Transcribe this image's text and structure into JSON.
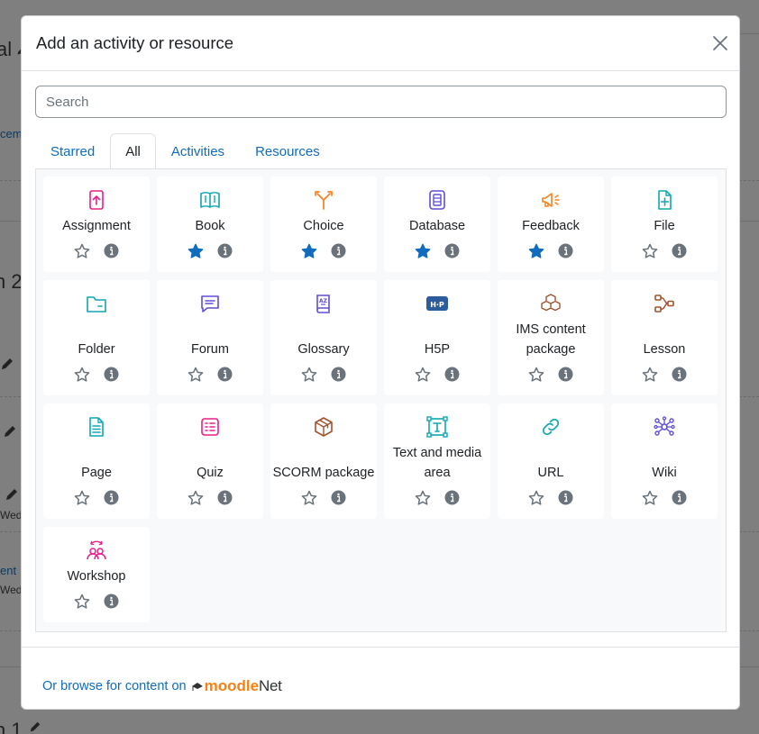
{
  "background": {
    "fragments": [
      {
        "id": "frag-al",
        "text": "al"
      },
      {
        "id": "frag-cem",
        "text": "cem"
      },
      {
        "id": "frag-n2",
        "text": "n 2"
      },
      {
        "id": "frag-ent",
        "text": "ent"
      },
      {
        "id": "frag-wed1",
        "text": "Wed"
      },
      {
        "id": "frag-wed2",
        "text": "Wed"
      },
      {
        "id": "frag-n1",
        "text": "n 1"
      }
    ]
  },
  "modal": {
    "title": "Add an activity or resource",
    "search": {
      "placeholder": "Search",
      "value": ""
    },
    "tabs": [
      {
        "label": "Starred",
        "active": false
      },
      {
        "label": "All",
        "active": true
      },
      {
        "label": "Activities",
        "active": false
      },
      {
        "label": "Resources",
        "active": false
      }
    ],
    "items": [
      {
        "name": "Assignment",
        "icon": "assignment-icon",
        "color": "#e91e8c",
        "starred": false
      },
      {
        "name": "Book",
        "icon": "book-icon",
        "color": "#11a7b3",
        "starred": true
      },
      {
        "name": "Choice",
        "icon": "choice-icon",
        "color": "#f7801c",
        "starred": true
      },
      {
        "name": "Database",
        "icon": "database-icon",
        "color": "#5f4ed6",
        "starred": true
      },
      {
        "name": "Feedback",
        "icon": "feedback-icon",
        "color": "#f7801c",
        "starred": true
      },
      {
        "name": "File",
        "icon": "file-icon",
        "color": "#11a7b3",
        "starred": false
      },
      {
        "name": "Folder",
        "icon": "folder-icon",
        "color": "#11a7b3",
        "starred": false
      },
      {
        "name": "Forum",
        "icon": "forum-icon",
        "color": "#5f4ed6",
        "starred": false
      },
      {
        "name": "Glossary",
        "icon": "glossary-icon",
        "color": "#5f4ed6",
        "starred": false
      },
      {
        "name": "H5P",
        "icon": "h5p-icon",
        "color": "#2c5c9c",
        "starred": false
      },
      {
        "name": "IMS content package",
        "icon": "ims-package-icon",
        "color": "#a0532e",
        "starred": false
      },
      {
        "name": "Lesson",
        "icon": "lesson-icon",
        "color": "#a0532e",
        "starred": false
      },
      {
        "name": "Page",
        "icon": "page-icon",
        "color": "#11a7b3",
        "starred": false
      },
      {
        "name": "Quiz",
        "icon": "quiz-icon",
        "color": "#e91e8c",
        "starred": false
      },
      {
        "name": "SCORM package",
        "icon": "scorm-icon",
        "color": "#a0532e",
        "starred": false
      },
      {
        "name": "Text and media area",
        "icon": "text-media-icon",
        "color": "#11a7b3",
        "starred": false
      },
      {
        "name": "URL",
        "icon": "url-icon",
        "color": "#11a7b3",
        "starred": false
      },
      {
        "name": "Wiki",
        "icon": "wiki-icon",
        "color": "#5f4ed6",
        "starred": false
      },
      {
        "name": "Workshop",
        "icon": "workshop-icon",
        "color": "#e91e8c",
        "starred": false
      }
    ],
    "footer": {
      "browse_text": "Or browse for content on",
      "brand_part1": "moodle",
      "brand_part2": "Net"
    }
  },
  "colors": {
    "link": "#0f6cbf",
    "star_filled": "#0f6cbf",
    "star_empty": "#6a737b",
    "info": "#6a737b"
  }
}
